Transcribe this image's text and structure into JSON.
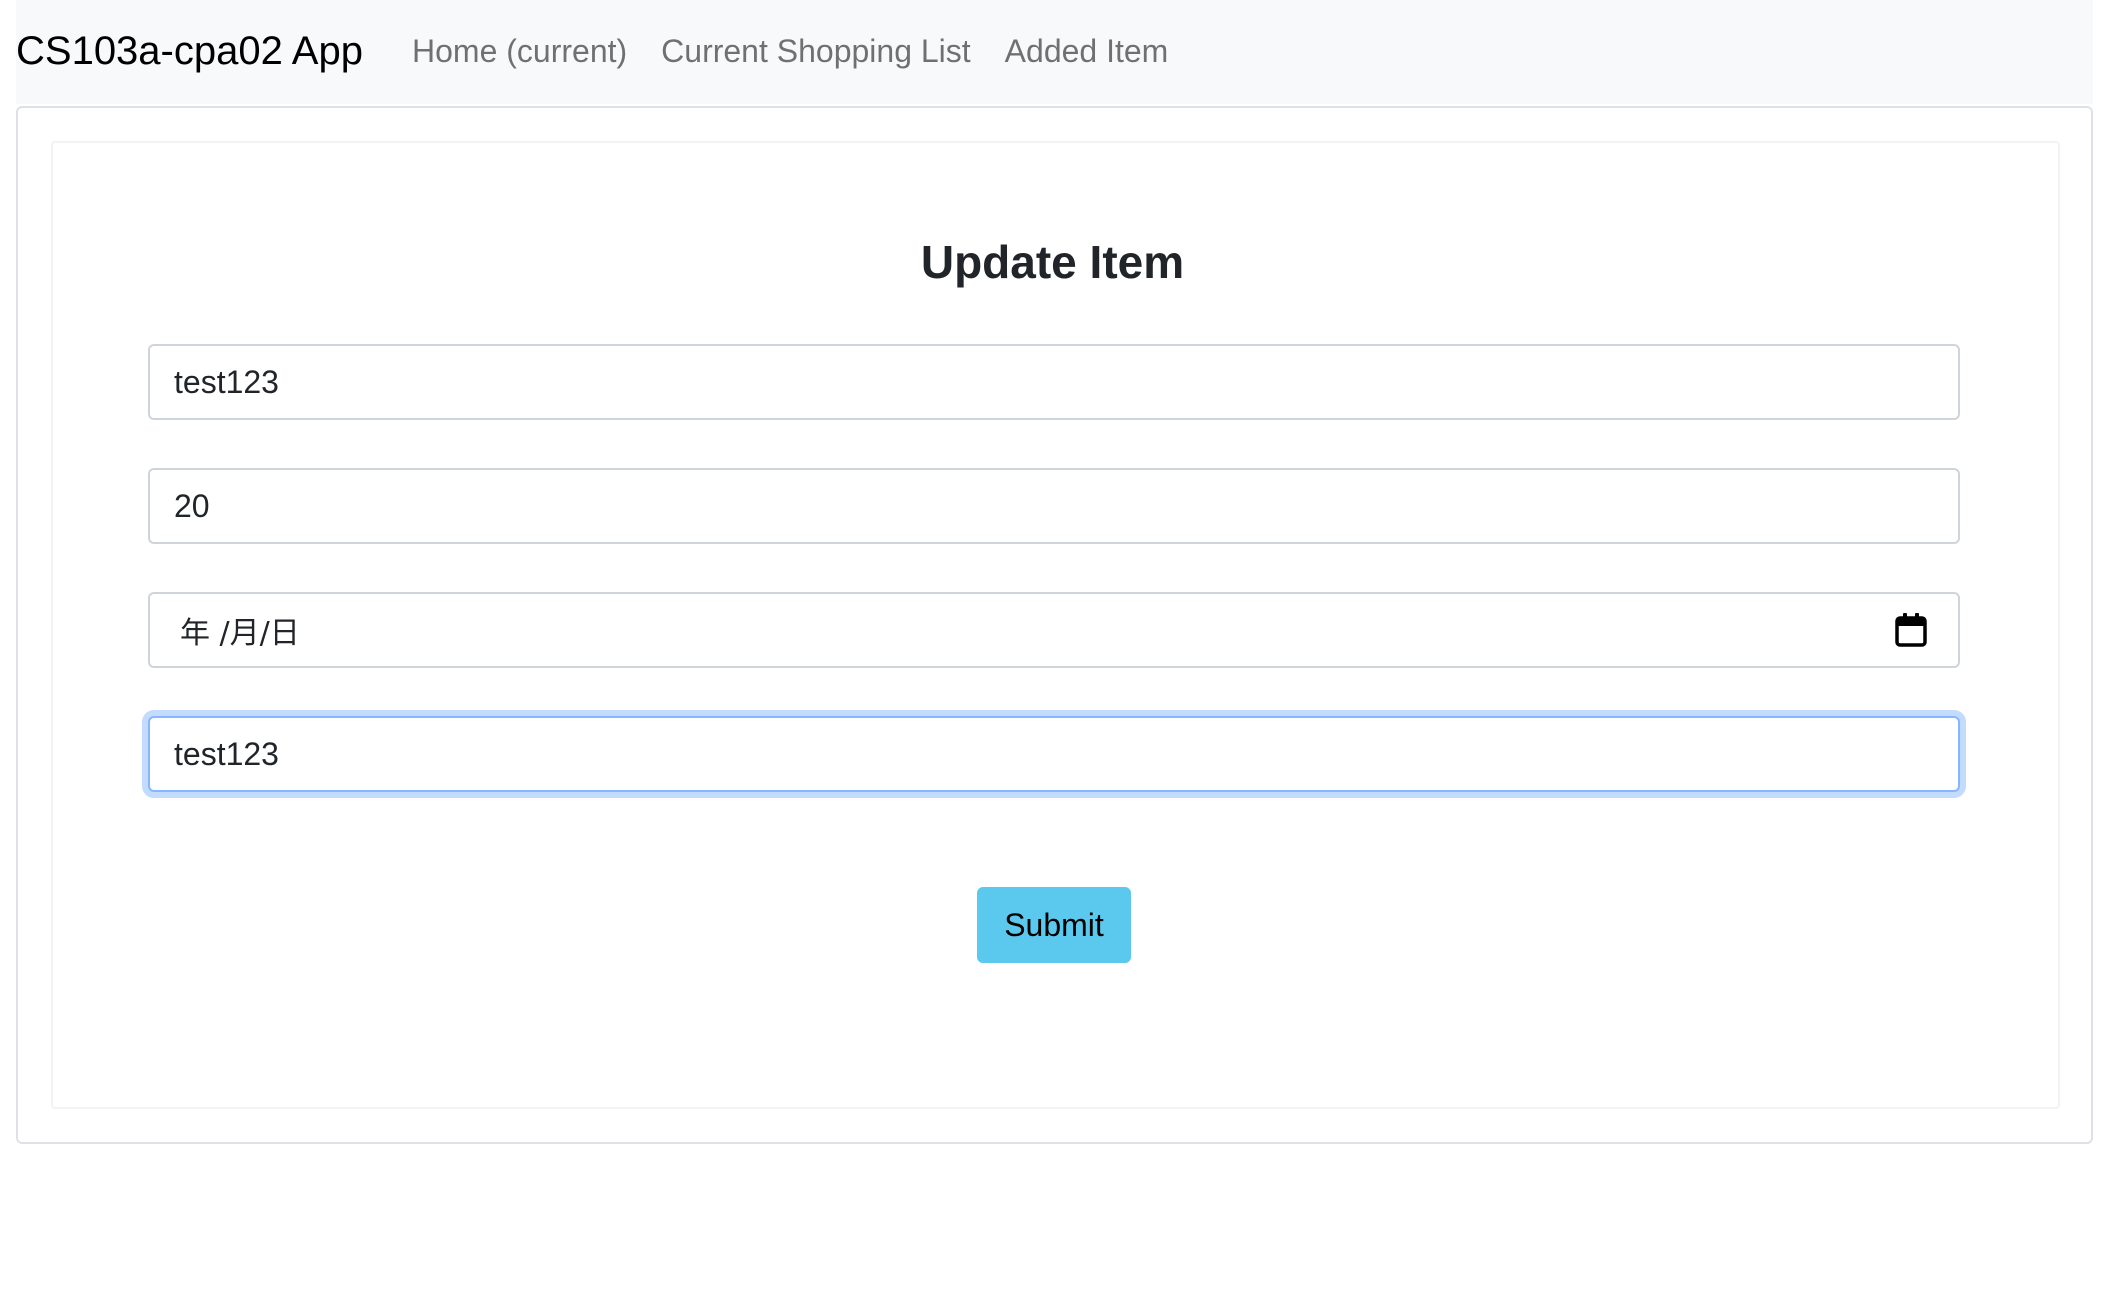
{
  "navbar": {
    "brand": "CS103a-cpa02 App",
    "links": [
      {
        "label": "Home (current)"
      },
      {
        "label": "Current Shopping List"
      },
      {
        "label": "Added Item"
      }
    ]
  },
  "form": {
    "title": "Update Item",
    "fields": [
      {
        "value": "test123"
      },
      {
        "value": "20"
      },
      {
        "value": "年 /月/日",
        "icon": "calendar-icon"
      },
      {
        "value": "test123",
        "focused": true
      }
    ],
    "submit_label": "Submit"
  },
  "colors": {
    "navbar_bg": "#f8f9fa",
    "submit_button": "#5bc8ee",
    "focus_ring": "#86b7fe"
  }
}
